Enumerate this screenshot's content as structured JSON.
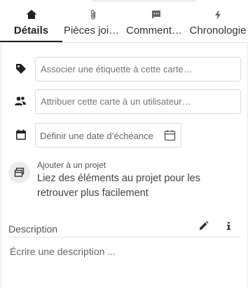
{
  "tabs": [
    {
      "label": "Détails",
      "icon": "home-icon",
      "active": true
    },
    {
      "label": "Pièces jointes",
      "icon": "paperclip-icon",
      "active": false
    },
    {
      "label": "Commentaires",
      "icon": "comment-icon",
      "active": false
    },
    {
      "label": "Chronologie",
      "icon": "lightning-icon",
      "active": false
    }
  ],
  "tag_field": {
    "placeholder": "Associer une étiquette à cette carte…",
    "icon": "tag-icon"
  },
  "user_field": {
    "placeholder": "Attribuer cette carte à un utilisateur…",
    "icon": "users-icon"
  },
  "date_field": {
    "placeholder": "Définir une date d’échéance",
    "icon": "calendar-icon",
    "picker_icon": "calendar-outline-icon"
  },
  "project": {
    "title": "Ajouter à un projet",
    "description": "Liez des éléments au projet pour les retrouver plus facilement",
    "icon": "project-icon"
  },
  "description": {
    "label": "Description",
    "placeholder": "Écrire une description ...",
    "edit_icon": "pencil-icon",
    "info_icon": "info-icon"
  },
  "colors": {
    "active_tab": "#222222",
    "border": "#dcdcdc",
    "icon": "#222222"
  }
}
